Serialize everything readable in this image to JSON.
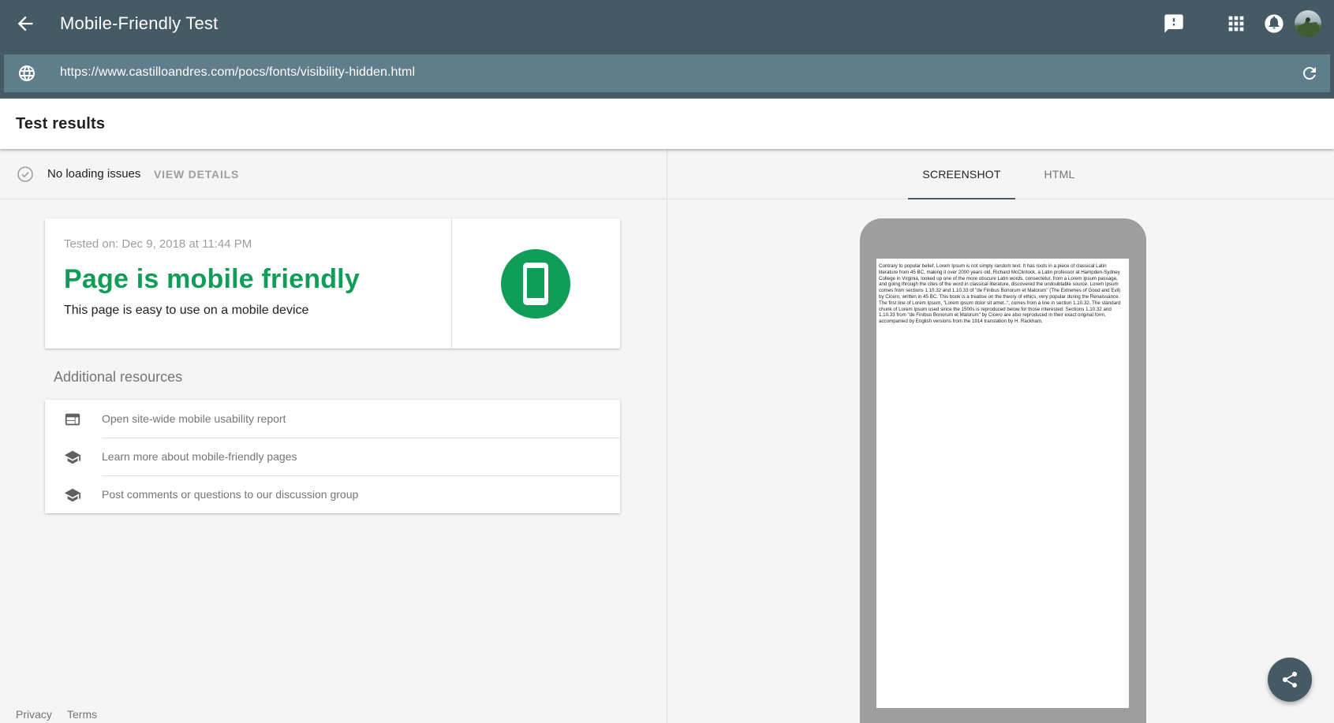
{
  "header": {
    "title": "Mobile-Friendly Test",
    "url": "https://www.castilloandres.com/pocs/fonts/visibility-hidden.html",
    "icons": [
      "back-arrow-icon",
      "feedback-icon",
      "apps-grid-icon",
      "notifications-icon",
      "avatar",
      "globe-icon",
      "refresh-icon"
    ]
  },
  "results": {
    "title": "Test results"
  },
  "status": {
    "text": "No loading issues",
    "details_label": "VIEW DETAILS"
  },
  "result_card": {
    "tested_on": "Tested on: Dec 9, 2018 at 11:44 PM",
    "verdict": "Page is mobile friendly",
    "subtitle": "This page is easy to use on a mobile device"
  },
  "additional": {
    "title": "Additional resources",
    "items": [
      {
        "label": "Open site-wide mobile usability report",
        "icon": "web-report-icon"
      },
      {
        "label": "Learn more about mobile-friendly pages",
        "icon": "school-icon"
      },
      {
        "label": "Post comments or questions to our discussion group",
        "icon": "school-icon"
      }
    ]
  },
  "footer": {
    "privacy": "Privacy",
    "terms": "Terms"
  },
  "tabs": [
    {
      "label": "SCREENSHOT",
      "active": true
    },
    {
      "label": "HTML",
      "active": false
    }
  ],
  "preview": {
    "text": "Contrary to popular belief, Lorem Ipsum is not simply random text. It has roots in a piece of classical Latin literature from 45 BC, making it over 2000 years old. Richard McClintock, a Latin professor at Hampden-Sydney College in Virginia, looked up one of the more obscure Latin words, consectetur, from a Lorem Ipsum passage, and going through the cites of the word in classical literature, discovered the undoubtable source. Lorem Ipsum comes from sections 1.10.32 and 1.10.33 of \"de Finibus Bonorum et Malorum\" (The Extremes of Good and Evil) by Cicero, written in 45 BC. This book is a treatise on the theory of ethics, very popular during the Renaissance. The first line of Lorem Ipsum, \"Lorem ipsum dolor sit amet..\", comes from a line in section 1.10.32. The standard chunk of Lorem Ipsum used since the 1500s is reproduced below for those interested. Sections 1.10.32 and 1.10.33 from \"de Finibus Bonorum et Malorum\" by Cicero are also reproduced in their exact original form, accompanied by English versions from the 1914 translation by H. Rackham."
  },
  "colors": {
    "appbar": "#455a64",
    "urlbar": "#607d8b",
    "success": "#0f9d58"
  }
}
